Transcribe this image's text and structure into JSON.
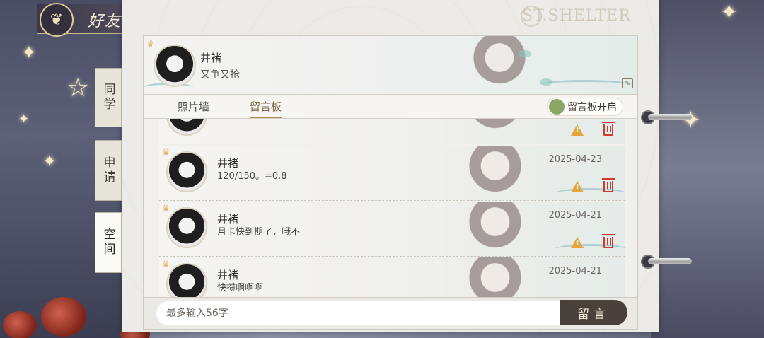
{
  "header": {
    "title": "好友",
    "brand": "ST.SHELTER"
  },
  "side_tabs": [
    {
      "label": "同学"
    },
    {
      "label": "申请"
    },
    {
      "label": "空间"
    }
  ],
  "profile": {
    "name": "井褚",
    "signature": "又争又抢"
  },
  "tabs": [
    {
      "label": "照片墙"
    },
    {
      "label": "留言板"
    }
  ],
  "board_toggle": {
    "label": "留言板开启",
    "color": "#8aa565"
  },
  "messages": [
    {
      "name": "井褚",
      "text": "120/150。=0.8",
      "date": "2025-04-23"
    },
    {
      "name": "井褚",
      "text": "月卡快到期了，哦不",
      "date": "2025-04-21"
    },
    {
      "name": "井褚",
      "text": "快攒啊啊啊",
      "date": "2025-04-21"
    }
  ],
  "composer": {
    "placeholder": "最多输入56字",
    "send_label": "留言"
  },
  "colors": {
    "accent": "#a48e5e",
    "delete": "#cf3b33",
    "report": "#e3a63a"
  }
}
